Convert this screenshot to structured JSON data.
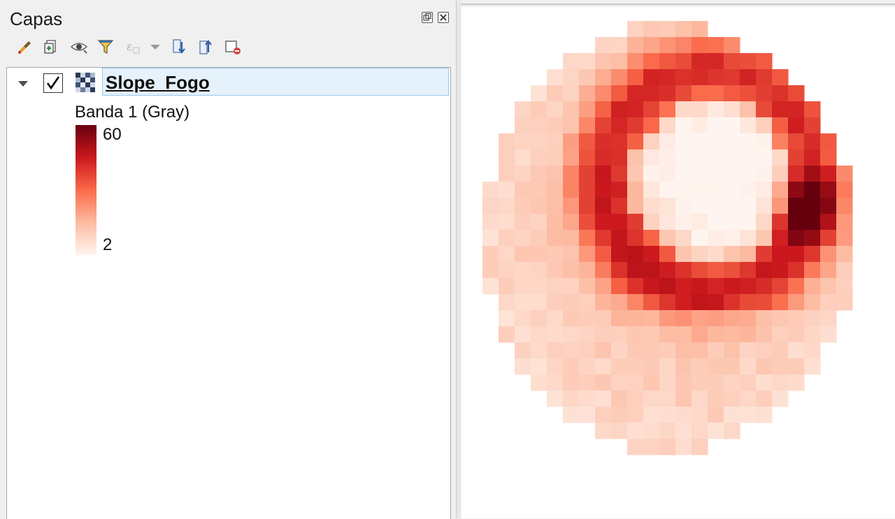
{
  "panel": {
    "title": "Capas",
    "float_icon": "float-icon",
    "close_icon": "close-icon"
  },
  "toolbar": {
    "items": [
      {
        "name": "style-layer-icon"
      },
      {
        "name": "add-group-icon"
      },
      {
        "name": "manage-visibility-icon"
      },
      {
        "name": "filter-legend-icon"
      },
      {
        "name": "filter-expression-icon"
      },
      {
        "name": "dropdown-arrow-icon"
      },
      {
        "name": "expand-all-icon"
      },
      {
        "name": "collapse-all-icon"
      },
      {
        "name": "remove-layer-icon"
      }
    ]
  },
  "layer": {
    "name": "Slope_Fogo",
    "checked": true,
    "checkmark": "✓",
    "band_label": "Banda 1 (Gray)",
    "legend_max": "60",
    "legend_min": "2",
    "ramp_colors": [
      "#67000d",
      "#cb181d",
      "#fb6a4a",
      "#fcbba1",
      "#fff5f0"
    ]
  },
  "map": {
    "background": "#ffffff"
  }
}
